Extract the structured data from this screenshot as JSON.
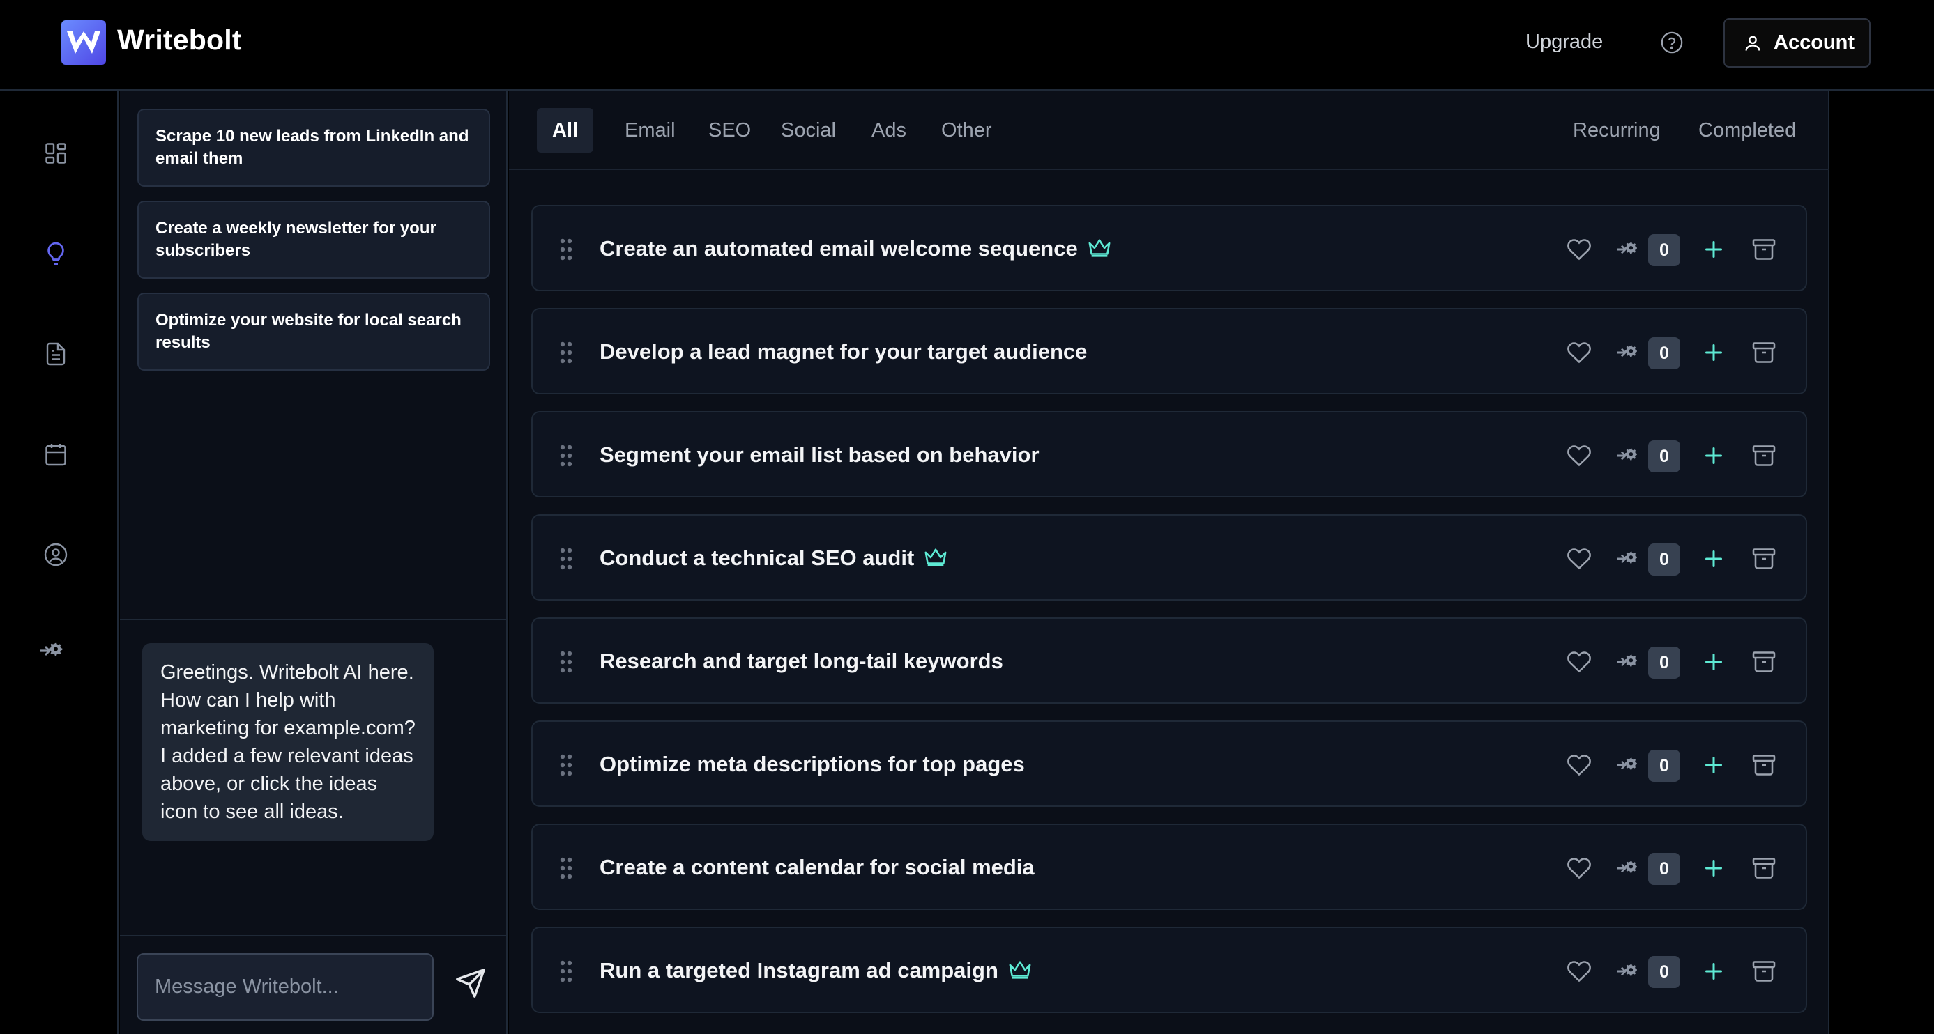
{
  "app": {
    "brand": "Writebolt"
  },
  "header": {
    "upgrade_label": "Upgrade",
    "account_label": "Account"
  },
  "ideas": [
    {
      "text": "Scrape 10 new leads from LinkedIn and email them"
    },
    {
      "text": "Create a weekly newsletter for your subscribers"
    },
    {
      "text": "Optimize your website for local search results"
    }
  ],
  "chat": {
    "greeting": "Greetings. Writebolt AI here. How can I help with marketing for example.com? I added a few relevant ideas above, or click the ideas icon to see all ideas.",
    "input_placeholder": "Message Writebolt..."
  },
  "tabs": {
    "all": "All",
    "email": "Email",
    "seo": "SEO",
    "social": "Social",
    "ads": "Ads",
    "other": "Other",
    "recurring": "Recurring",
    "completed": "Completed"
  },
  "tasks": [
    {
      "title": "Create an automated email welcome sequence",
      "premium": true,
      "count": "0"
    },
    {
      "title": "Develop a lead magnet for your target audience",
      "premium": false,
      "count": "0"
    },
    {
      "title": "Segment your email list based on behavior",
      "premium": false,
      "count": "0"
    },
    {
      "title": "Conduct a technical SEO audit",
      "premium": true,
      "count": "0"
    },
    {
      "title": "Research and target long-tail keywords",
      "premium": false,
      "count": "0"
    },
    {
      "title": "Optimize meta descriptions for top pages",
      "premium": false,
      "count": "0"
    },
    {
      "title": "Create a content calendar for social media",
      "premium": false,
      "count": "0"
    },
    {
      "title": "Run a targeted Instagram ad campaign",
      "premium": true,
      "count": "0"
    }
  ],
  "colors": {
    "accent": "#5eead4",
    "brand": "#4f46e5",
    "active_rail": "#6366f1"
  }
}
